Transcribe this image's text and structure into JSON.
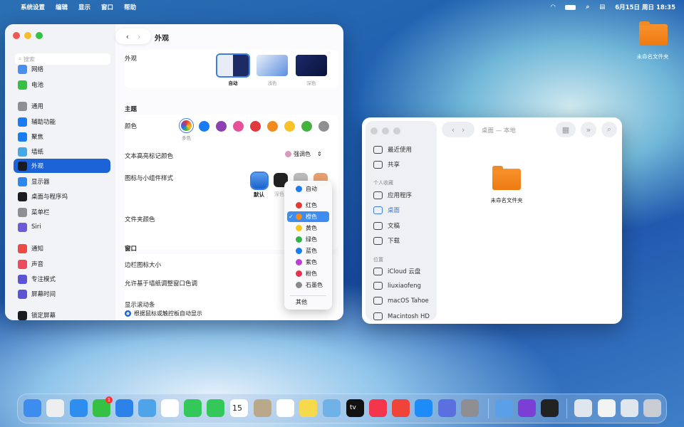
{
  "menubar": {
    "app": "系统设置",
    "items": [
      "编辑",
      "显示",
      "窗口",
      "帮助"
    ],
    "date": "6月15日 周日",
    "time": "18:35"
  },
  "desktop": {
    "folder_label": "未命名文件夹"
  },
  "settings": {
    "title": "外观",
    "search_placeholder": "搜索",
    "sidebar": [
      "网络",
      "电池",
      "通用",
      "辅助功能",
      "聚焦",
      "墙纸",
      "外观",
      "显示器",
      "桌面与程序坞",
      "菜单栏",
      "Siri",
      "通知",
      "声音",
      "专注模式",
      "屏幕时间",
      "锁定屏幕"
    ],
    "appearance_label": "外观",
    "appearance_options": [
      "自动",
      "浅色",
      "深色"
    ],
    "theme_heading": "主题",
    "color_label": "颜色",
    "multicolor_label": "多色",
    "accent_colors": [
      "#1a7cf2",
      "#8e3fb0",
      "#e8509a",
      "#e0383e",
      "#f28a1e",
      "#f7c329",
      "#45b240",
      "#8f8f93"
    ],
    "highlight_label": "文本高亮标记颜色",
    "highlight_value": "强调色",
    "icon_style_label": "图标与小组件样式",
    "icon_style_options": [
      "默认",
      "深色"
    ],
    "folder_color_label": "文件夹颜色",
    "window_heading": "窗口",
    "sidebar_icon_size_label": "边栏图标大小",
    "tint_label": "允许基于墙纸调整窗口色调",
    "scrollbar_label": "显示滚动条",
    "scrollbar_option": "根据鼠标或触控板自动显示"
  },
  "folder_menu": {
    "items": [
      {
        "label": "自动",
        "color": "#1a7cf2"
      },
      {
        "label": "红色",
        "color": "#e53935"
      },
      {
        "label": "橙色",
        "color": "#f28a1e",
        "selected": true
      },
      {
        "label": "黄色",
        "color": "#f5c518"
      },
      {
        "label": "绿色",
        "color": "#34b24a"
      },
      {
        "label": "蓝色",
        "color": "#1a7cf2"
      },
      {
        "label": "紫色",
        "color": "#b93fd6"
      },
      {
        "label": "粉色",
        "color": "#e8304f"
      },
      {
        "label": "石墨色",
        "color": "#8a8a8e"
      }
    ],
    "other": "其他",
    "check": "✓"
  },
  "finder": {
    "title": "桌面 — 本地",
    "items_top": [
      "最近使用",
      "共享"
    ],
    "favorites_heading": "个人收藏",
    "favorites": [
      "应用程序",
      "桌面",
      "文稿",
      "下载"
    ],
    "locations_heading": "位置",
    "locations": [
      "iCloud 云盘",
      "liuxiaofeng",
      "macOS Tahoe",
      "Macintosh HD"
    ],
    "folder_label": "未命名文件夹"
  },
  "dock": {
    "calendar_day": "15",
    "messages_badge": "1",
    "tv_label": "tv"
  }
}
